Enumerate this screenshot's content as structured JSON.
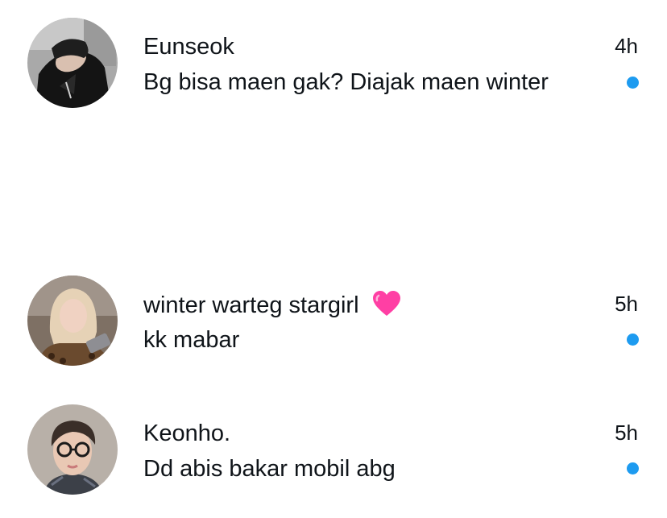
{
  "threads": [
    {
      "name": "Eunseok",
      "message": "Bg bisa maen gak? Diajak maen winter",
      "time": "4h",
      "unread": true,
      "avatar_icon": "user-avatar-hooded-figure"
    },
    {
      "name": "winter warteg stargirl",
      "name_emoji": "pink-heart-emoji",
      "message": "kk mabar",
      "time": "5h",
      "unread": true,
      "avatar_icon": "user-avatar-blonde-girl-with-phone"
    },
    {
      "name": "Keonho.",
      "message": "Dd abis bakar mobil abg",
      "time": "5h",
      "unread": true,
      "avatar_icon": "user-avatar-boy-with-glasses"
    }
  ],
  "colors": {
    "unread_dot": "#1d9bf0",
    "text": "#0f1419",
    "heart": "#ff3fa4"
  }
}
